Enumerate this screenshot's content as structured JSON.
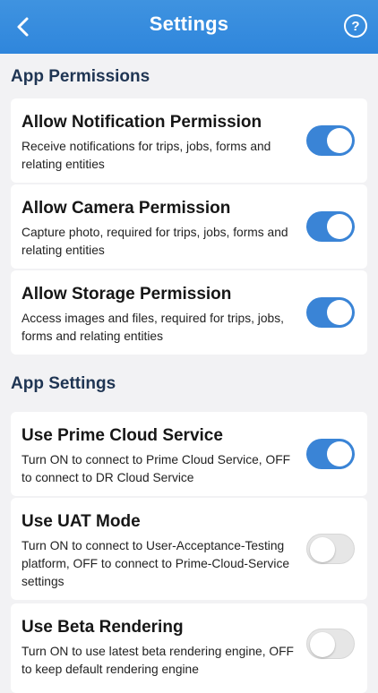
{
  "header": {
    "title": "Settings",
    "back_icon": "chevron-left-icon",
    "help_label": "?"
  },
  "sections": [
    {
      "title": "App Permissions",
      "items": [
        {
          "title": "Allow Notification Permission",
          "desc": "Receive notifications for trips, jobs, forms and relating entities",
          "enabled": true
        },
        {
          "title": "Allow Camera Permission",
          "desc": "Capture photo, required for trips, jobs, forms and relating entities",
          "enabled": true
        },
        {
          "title": "Allow Storage Permission",
          "desc": "Access images and files, required for trips, jobs, forms and relating entities",
          "enabled": true
        }
      ]
    },
    {
      "title": "App Settings",
      "items": [
        {
          "title": "Use Prime Cloud Service",
          "desc": "Turn ON to connect to Prime Cloud Service, OFF to connect to DR Cloud Service",
          "enabled": true
        },
        {
          "title": "Use UAT Mode",
          "desc": "Turn ON to connect to User-Acceptance-Testing platform, OFF to connect to Prime-Cloud-Service settings",
          "enabled": false
        },
        {
          "title": "Use Beta Rendering",
          "desc": "Turn ON to use latest beta rendering engine, OFF to keep default rendering engine",
          "enabled": false
        }
      ]
    }
  ],
  "colors": {
    "header": "#2f86dc",
    "toggle_on": "#3a84d6",
    "toggle_off": "#e6e6e6",
    "section_title": "#1f3553"
  }
}
